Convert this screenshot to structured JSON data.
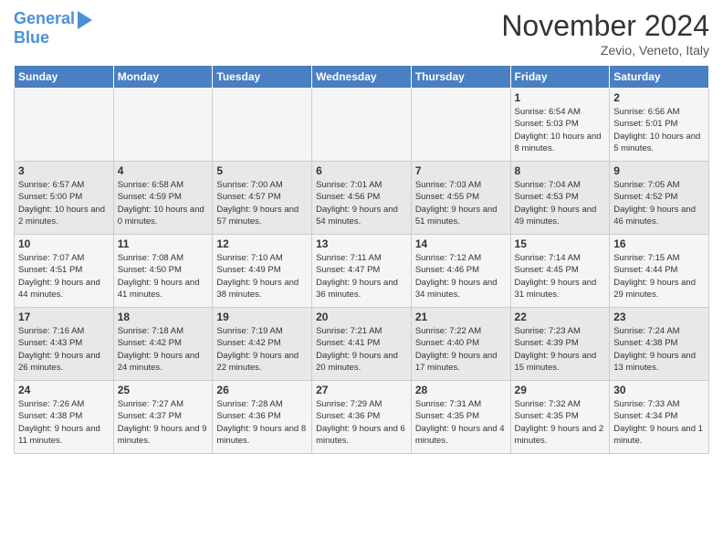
{
  "logo": {
    "line1": "General",
    "line2": "Blue"
  },
  "header": {
    "month": "November 2024",
    "location": "Zevio, Veneto, Italy"
  },
  "days_of_week": [
    "Sunday",
    "Monday",
    "Tuesday",
    "Wednesday",
    "Thursday",
    "Friday",
    "Saturday"
  ],
  "weeks": [
    [
      {
        "day": "",
        "info": ""
      },
      {
        "day": "",
        "info": ""
      },
      {
        "day": "",
        "info": ""
      },
      {
        "day": "",
        "info": ""
      },
      {
        "day": "",
        "info": ""
      },
      {
        "day": "1",
        "info": "Sunrise: 6:54 AM\nSunset: 5:03 PM\nDaylight: 10 hours and 8 minutes."
      },
      {
        "day": "2",
        "info": "Sunrise: 6:56 AM\nSunset: 5:01 PM\nDaylight: 10 hours and 5 minutes."
      }
    ],
    [
      {
        "day": "3",
        "info": "Sunrise: 6:57 AM\nSunset: 5:00 PM\nDaylight: 10 hours and 2 minutes."
      },
      {
        "day": "4",
        "info": "Sunrise: 6:58 AM\nSunset: 4:59 PM\nDaylight: 10 hours and 0 minutes."
      },
      {
        "day": "5",
        "info": "Sunrise: 7:00 AM\nSunset: 4:57 PM\nDaylight: 9 hours and 57 minutes."
      },
      {
        "day": "6",
        "info": "Sunrise: 7:01 AM\nSunset: 4:56 PM\nDaylight: 9 hours and 54 minutes."
      },
      {
        "day": "7",
        "info": "Sunrise: 7:03 AM\nSunset: 4:55 PM\nDaylight: 9 hours and 51 minutes."
      },
      {
        "day": "8",
        "info": "Sunrise: 7:04 AM\nSunset: 4:53 PM\nDaylight: 9 hours and 49 minutes."
      },
      {
        "day": "9",
        "info": "Sunrise: 7:05 AM\nSunset: 4:52 PM\nDaylight: 9 hours and 46 minutes."
      }
    ],
    [
      {
        "day": "10",
        "info": "Sunrise: 7:07 AM\nSunset: 4:51 PM\nDaylight: 9 hours and 44 minutes."
      },
      {
        "day": "11",
        "info": "Sunrise: 7:08 AM\nSunset: 4:50 PM\nDaylight: 9 hours and 41 minutes."
      },
      {
        "day": "12",
        "info": "Sunrise: 7:10 AM\nSunset: 4:49 PM\nDaylight: 9 hours and 38 minutes."
      },
      {
        "day": "13",
        "info": "Sunrise: 7:11 AM\nSunset: 4:47 PM\nDaylight: 9 hours and 36 minutes."
      },
      {
        "day": "14",
        "info": "Sunrise: 7:12 AM\nSunset: 4:46 PM\nDaylight: 9 hours and 34 minutes."
      },
      {
        "day": "15",
        "info": "Sunrise: 7:14 AM\nSunset: 4:45 PM\nDaylight: 9 hours and 31 minutes."
      },
      {
        "day": "16",
        "info": "Sunrise: 7:15 AM\nSunset: 4:44 PM\nDaylight: 9 hours and 29 minutes."
      }
    ],
    [
      {
        "day": "17",
        "info": "Sunrise: 7:16 AM\nSunset: 4:43 PM\nDaylight: 9 hours and 26 minutes."
      },
      {
        "day": "18",
        "info": "Sunrise: 7:18 AM\nSunset: 4:42 PM\nDaylight: 9 hours and 24 minutes."
      },
      {
        "day": "19",
        "info": "Sunrise: 7:19 AM\nSunset: 4:42 PM\nDaylight: 9 hours and 22 minutes."
      },
      {
        "day": "20",
        "info": "Sunrise: 7:21 AM\nSunset: 4:41 PM\nDaylight: 9 hours and 20 minutes."
      },
      {
        "day": "21",
        "info": "Sunrise: 7:22 AM\nSunset: 4:40 PM\nDaylight: 9 hours and 17 minutes."
      },
      {
        "day": "22",
        "info": "Sunrise: 7:23 AM\nSunset: 4:39 PM\nDaylight: 9 hours and 15 minutes."
      },
      {
        "day": "23",
        "info": "Sunrise: 7:24 AM\nSunset: 4:38 PM\nDaylight: 9 hours and 13 minutes."
      }
    ],
    [
      {
        "day": "24",
        "info": "Sunrise: 7:26 AM\nSunset: 4:38 PM\nDaylight: 9 hours and 11 minutes."
      },
      {
        "day": "25",
        "info": "Sunrise: 7:27 AM\nSunset: 4:37 PM\nDaylight: 9 hours and 9 minutes."
      },
      {
        "day": "26",
        "info": "Sunrise: 7:28 AM\nSunset: 4:36 PM\nDaylight: 9 hours and 8 minutes."
      },
      {
        "day": "27",
        "info": "Sunrise: 7:29 AM\nSunset: 4:36 PM\nDaylight: 9 hours and 6 minutes."
      },
      {
        "day": "28",
        "info": "Sunrise: 7:31 AM\nSunset: 4:35 PM\nDaylight: 9 hours and 4 minutes."
      },
      {
        "day": "29",
        "info": "Sunrise: 7:32 AM\nSunset: 4:35 PM\nDaylight: 9 hours and 2 minutes."
      },
      {
        "day": "30",
        "info": "Sunrise: 7:33 AM\nSunset: 4:34 PM\nDaylight: 9 hours and 1 minute."
      }
    ]
  ]
}
